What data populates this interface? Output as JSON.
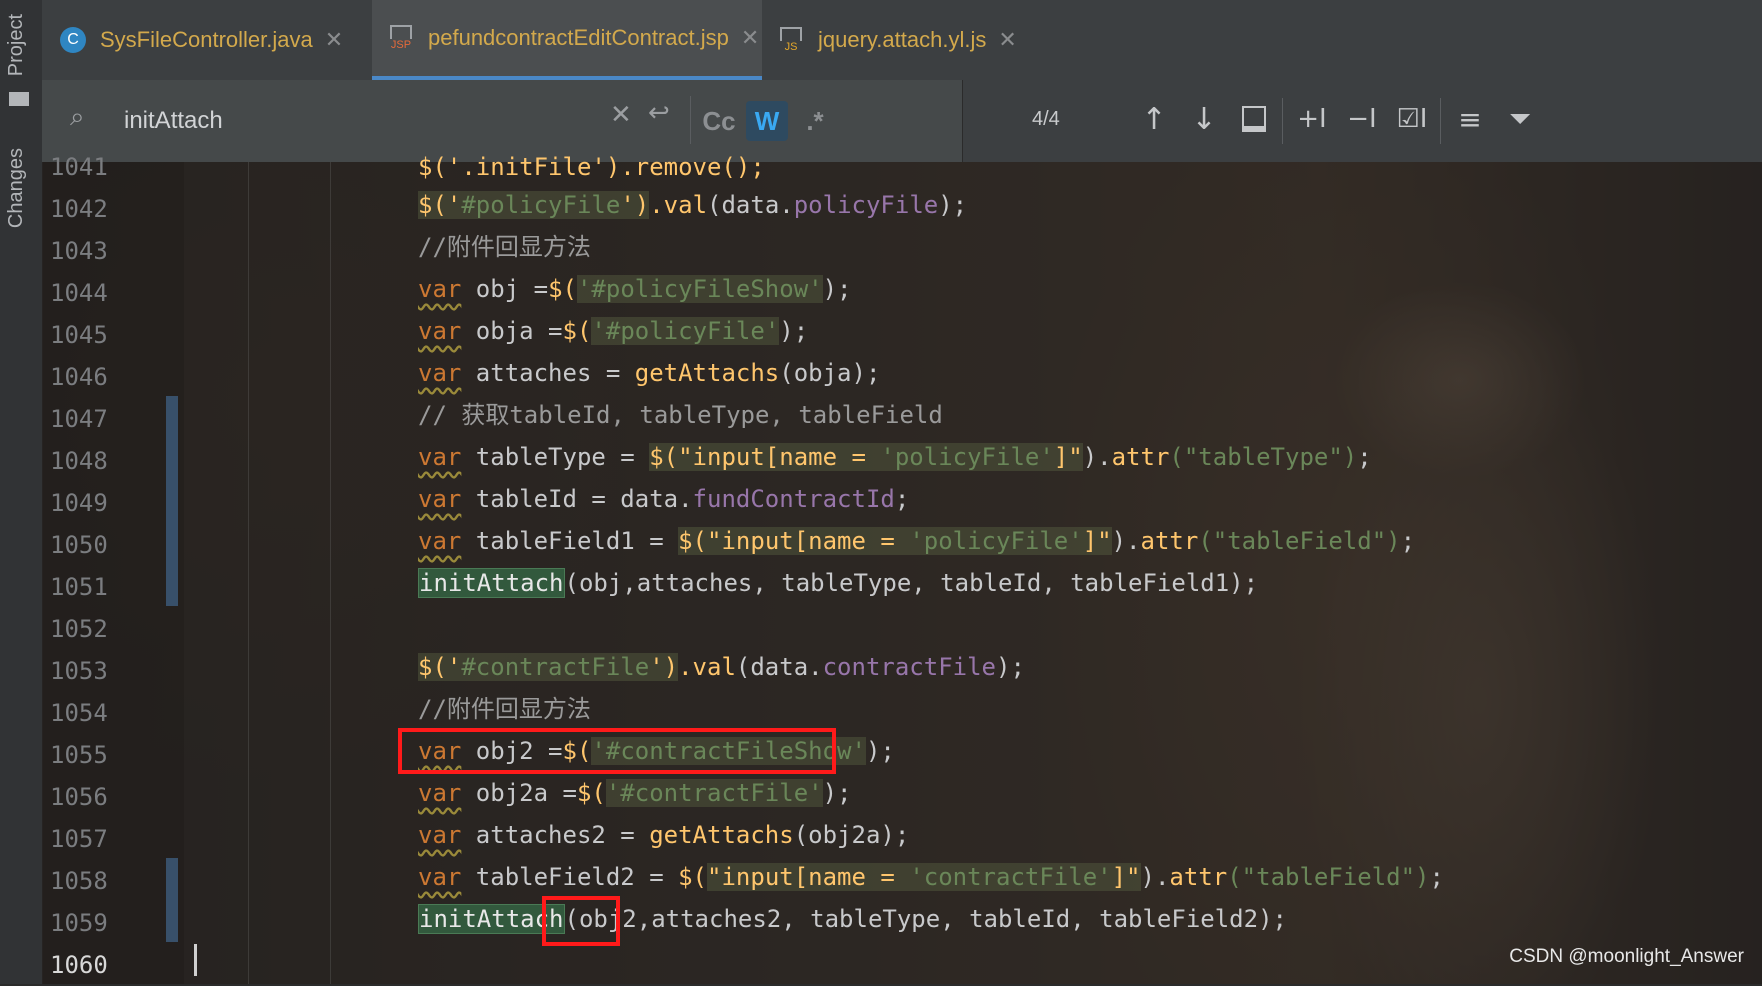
{
  "side": {
    "project_tab": "Project",
    "changes_tab": "Changes"
  },
  "tabs": [
    {
      "icon": "C",
      "label": "SysFileController.java",
      "active": false
    },
    {
      "icon": "JSP",
      "label": "pefundcontractEditContract.jsp",
      "active": true
    },
    {
      "icon": "JS",
      "label": "jquery.attach.yl.js",
      "active": false
    }
  ],
  "search": {
    "query": "initAttach",
    "match_case_label": "Cc",
    "words_label": "W",
    "regex_label": ".*",
    "match_count": "4/4"
  },
  "line_numbers": [
    "1041",
    "1042",
    "1043",
    "1044",
    "1045",
    "1046",
    "1047",
    "1048",
    "1049",
    "1050",
    "1051",
    "1052",
    "1053",
    "1054",
    "1055",
    "1056",
    "1057",
    "1058",
    "1059",
    "1060"
  ],
  "code": {
    "l1041": "$('.initFile').remove();",
    "l1042": {
      "a": "$('",
      "b": "#policyFile",
      "c": "')",
      "d": ".val",
      "e": "(data.",
      "f": "policyFile",
      "g": ");"
    },
    "l1043": "//附件回显方法",
    "l1044": {
      "kw": "var",
      "rest": " obj =",
      "dl": "$(",
      "s": "'#policyFileShow'",
      "end": ");"
    },
    "l1045": {
      "kw": "var",
      "rest": " obja =",
      "dl": "$(",
      "s": "'#policyFile'",
      "end": ");"
    },
    "l1046": {
      "kw": "var",
      "rest": " attaches = ",
      "fn": "getAttachs",
      "end": "(obja);"
    },
    "l1047": "// 获取tableId, tableType, tableField",
    "l1048": {
      "kw": "var",
      "rest": " tableType = ",
      "dl": "$(",
      "s1": "\"input[name = ",
      "s2": "'policyFile'",
      "s3": "]\"",
      "mid": ").",
      "fn": "attr",
      "s4": "(\"tableType\")",
      "end": ";"
    },
    "l1049": {
      "kw": "var",
      "rest": " tableId = data.",
      "prop": "fundContractId",
      "end": ";"
    },
    "l1050": {
      "kw": "var",
      "rest": " tableField1 = ",
      "dl": "$(",
      "s1": "\"input[name = ",
      "s2": "'policyFile'",
      "s3": "]\"",
      "mid": ").",
      "fn": "attr",
      "s4": "(\"tableField\")",
      "end": ";"
    },
    "l1051": {
      "fn": "initAttach",
      "end": "(obj,attaches, tableType, tableId, tableField1);"
    },
    "l1053": {
      "a": "$('",
      "b": "#contractFile",
      "c": "')",
      "d": ".val",
      "e": "(data.",
      "f": "contractFile",
      "g": ");"
    },
    "l1054": "//附件回显方法",
    "l1055": {
      "kw": "var",
      "rest": " obj2 =",
      "dl": "$(",
      "s": "'#contractFileShow'",
      "end": ");"
    },
    "l1056": {
      "kw": "var",
      "rest": " obj2a =",
      "dl": "$(",
      "s": "'#contractFile'",
      "end": ");"
    },
    "l1057": {
      "kw": "var",
      "rest": " attaches2 = ",
      "fn": "getAttachs",
      "end": "(obj2a);"
    },
    "l1058": {
      "kw": "var",
      "rest": " tableField2 = ",
      "dl": "$(",
      "s1": "\"input[name = ",
      "s2": "'contractFile'",
      "s3": "]\"",
      "mid": ").",
      "fn": "attr",
      "s4": "(\"tableField\")",
      "end": ";"
    },
    "l1059": {
      "fn": "initAttach",
      "boxed": "(obj2,",
      "end": "attaches2, tableType, tableId, tableField2);"
    }
  },
  "watermark": "CSDN @moonlight_Answer",
  "colors": {
    "highlight_box": "#ff1a1a",
    "tab_active_underline": "#4a88c7",
    "keyword": "#cc7832",
    "function": "#ffc66d",
    "string": "#6a8759"
  }
}
